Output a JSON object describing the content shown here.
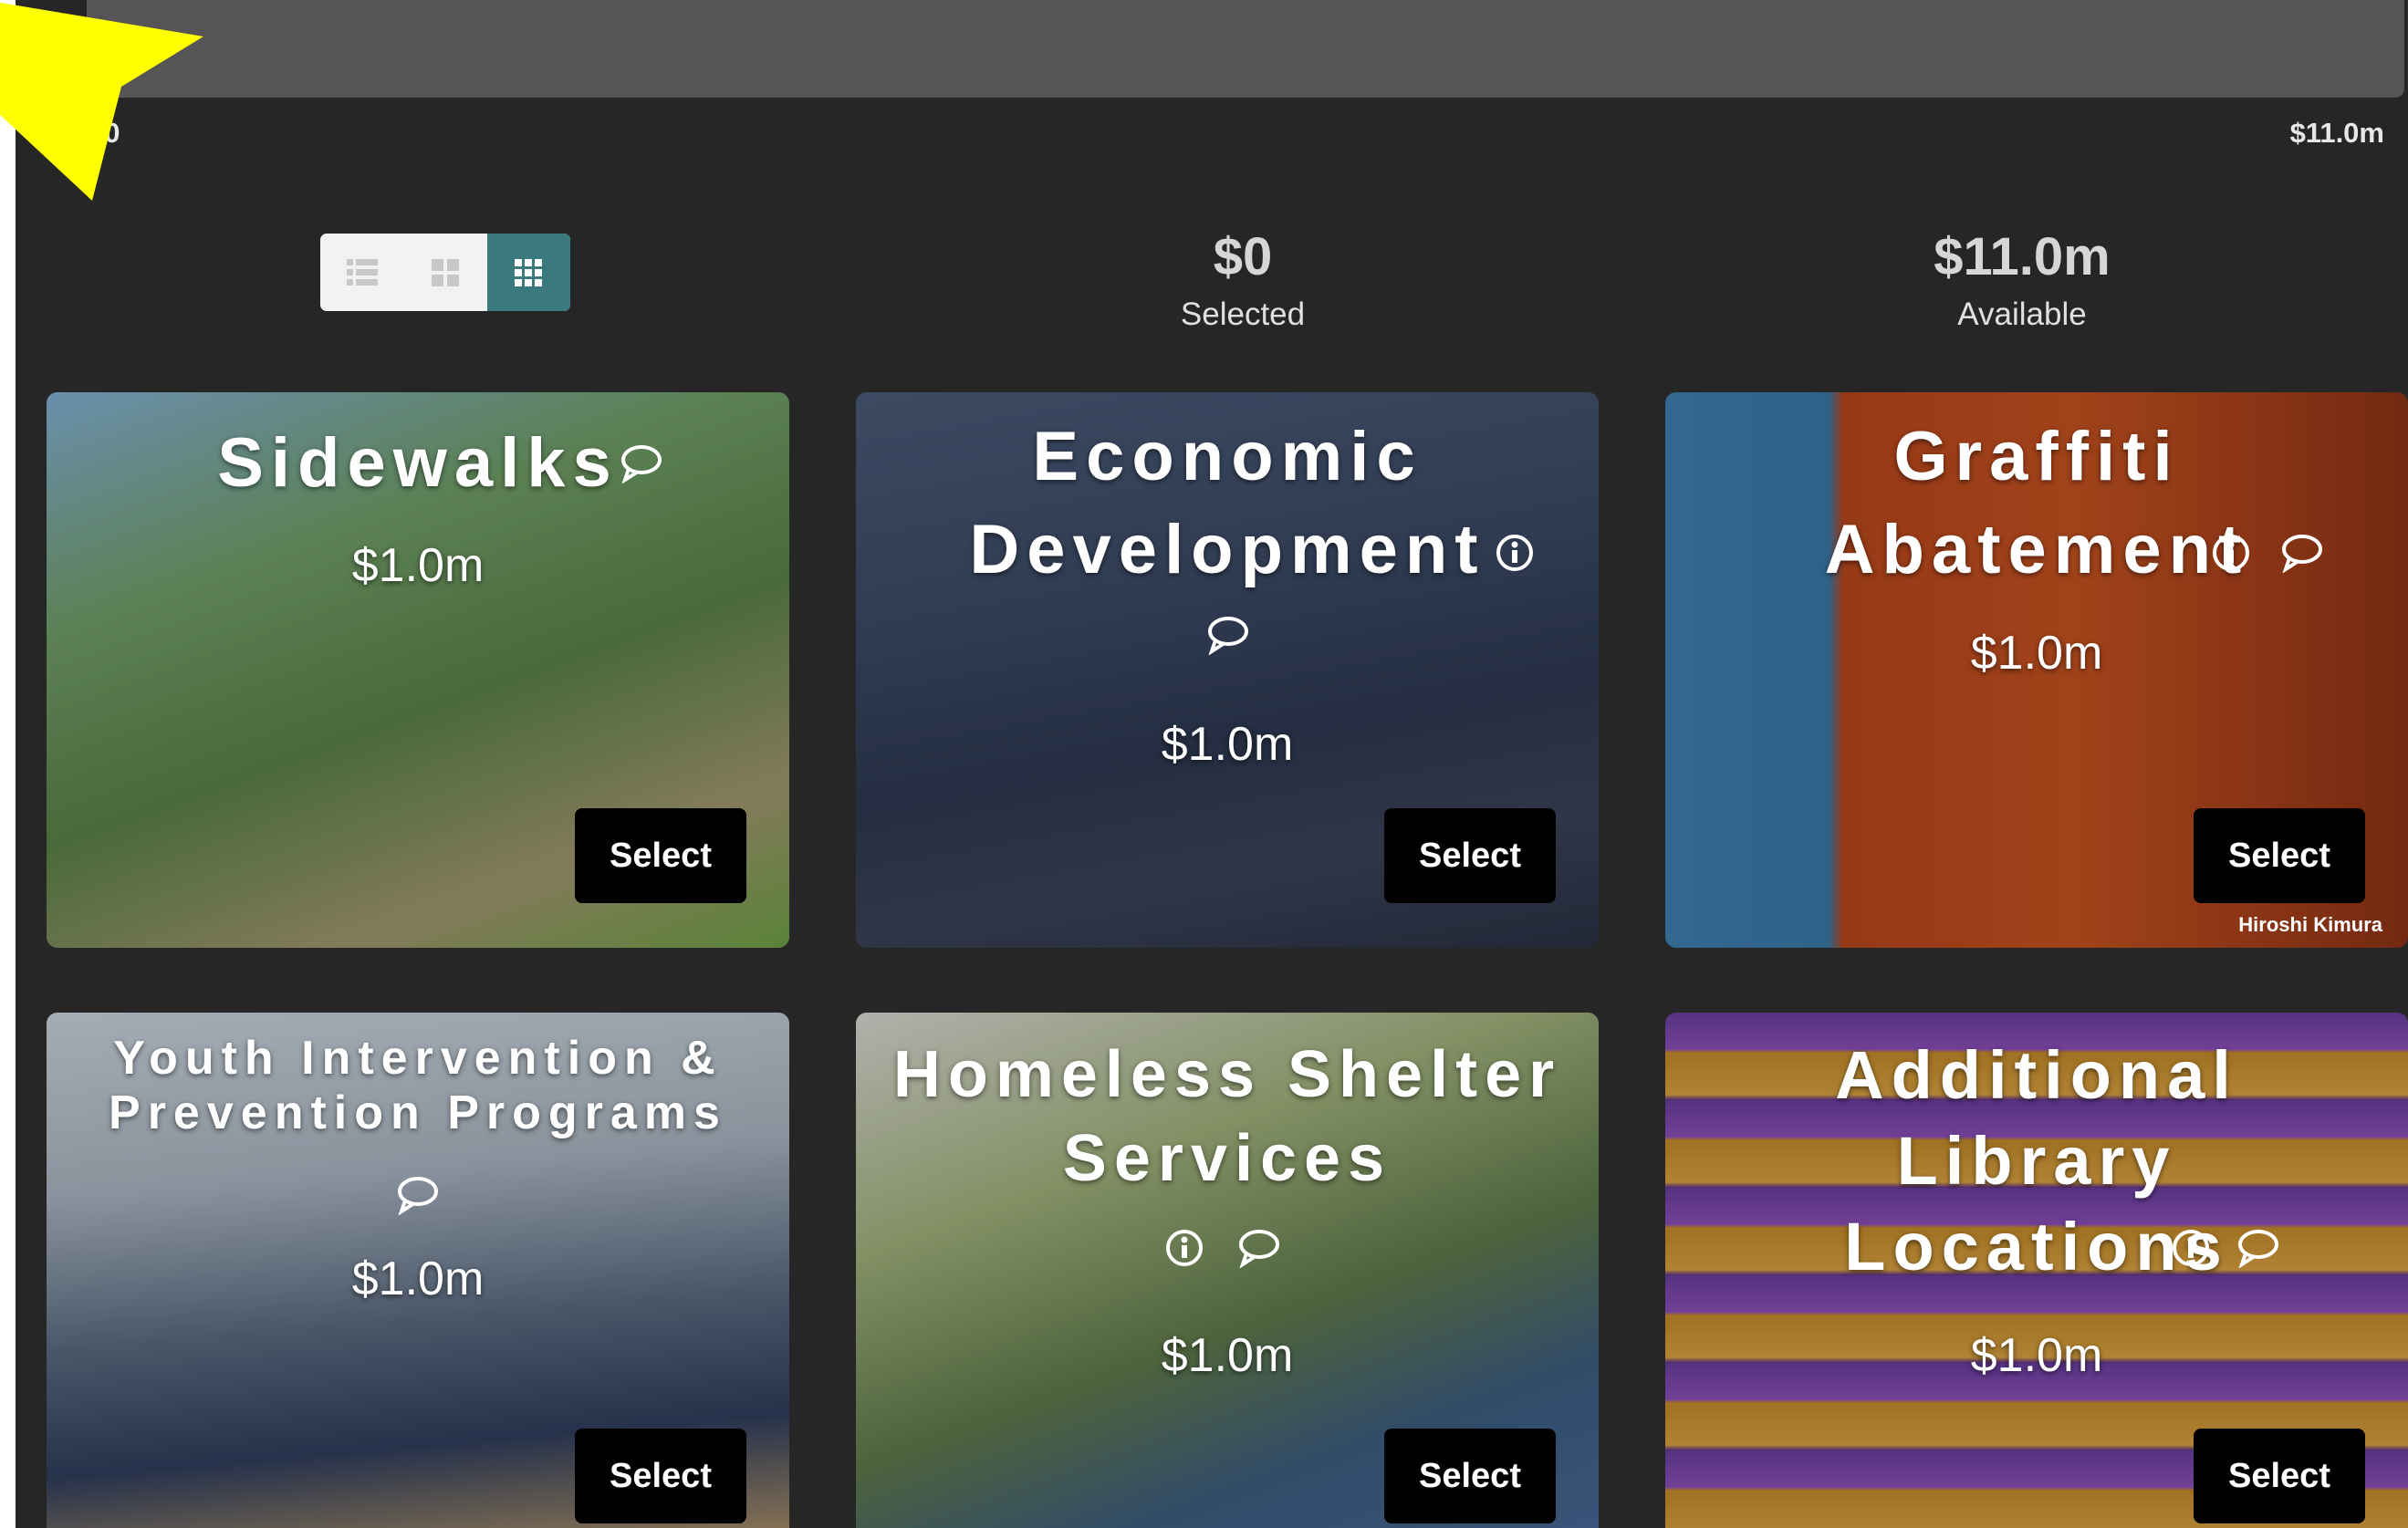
{
  "budget": {
    "scale_min": "$0",
    "scale_max": "$11.0m",
    "progress_fraction": 0
  },
  "view_modes": [
    "list",
    "large-grid",
    "small-grid"
  ],
  "view_mode_selected": "small-grid",
  "summary": {
    "selected_amount": "$0",
    "selected_label": "Selected",
    "available_amount": "$11.0m",
    "available_label": "Available"
  },
  "cards": [
    {
      "title": "Sidewalks",
      "price": "$1.0m",
      "select_label": "Select",
      "info": false,
      "comment": true
    },
    {
      "title": "Economic Development",
      "price": "$1.0m",
      "select_label": "Select",
      "info": true,
      "comment": true
    },
    {
      "title": "Graffiti Abatement",
      "price": "$1.0m",
      "select_label": "Select",
      "info": true,
      "comment": true,
      "credit": "Hiroshi Kimura"
    },
    {
      "title": "Youth Intervention & Prevention Programs",
      "price": "$1.0m",
      "select_label": "Select",
      "info": false,
      "comment": true
    },
    {
      "title": "Homeless Shelter Services",
      "price": "$1.0m",
      "select_label": "Select",
      "info": true,
      "comment": true
    },
    {
      "title": "Additional Library Locations",
      "price": "$1.0m",
      "select_label": "Select",
      "info": true,
      "comment": true
    }
  ],
  "colors": {
    "background": "#262626",
    "progress_track": "#555555",
    "toggle_active": "#3a7a7e",
    "pointer": "#ffff00"
  }
}
